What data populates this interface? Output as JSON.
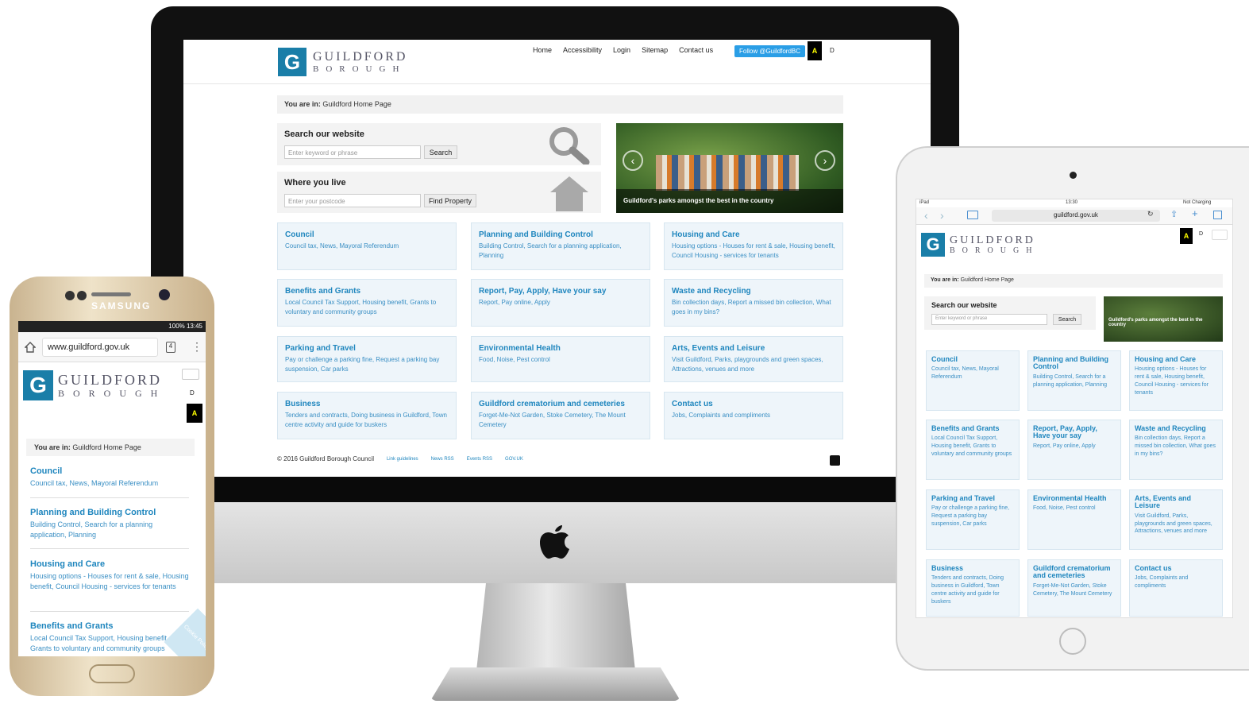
{
  "site": {
    "logo_letter": "G",
    "logo_line1": "GUILDFORD",
    "logo_line2": "BOROUGH",
    "nav": [
      "Home",
      "Accessibility",
      "Login",
      "Sitemap",
      "Contact us"
    ],
    "twitter": "Follow @GuildfordBC",
    "contrast_a": "A",
    "contrast_d": "D",
    "breadcrumb_prefix": "You are in:",
    "breadcrumb_page": "Guildford Home Page",
    "search_title": "Search our website",
    "search_placeholder": "Enter keyword or phrase",
    "search_button": "Search",
    "where_title": "Where you live",
    "postcode_placeholder": "Enter your postcode",
    "find_button": "Find Property",
    "carousel_caption": "Guildford's parks amongst the best in the country",
    "cards": [
      {
        "title": "Council",
        "desc": "Council tax, News, Mayoral Referendum"
      },
      {
        "title": "Planning and Building Control",
        "desc": "Building Control, Search for a planning application, Planning"
      },
      {
        "title": "Housing and Care",
        "desc": "Housing options - Houses for rent & sale, Housing benefit, Council Housing - services for tenants"
      },
      {
        "title": "Benefits and Grants",
        "desc": "Local Council Tax Support, Housing benefit, Grants to voluntary and community groups"
      },
      {
        "title": "Report, Pay, Apply, Have your say",
        "desc": "Report, Pay online, Apply"
      },
      {
        "title": "Waste and Recycling",
        "desc": "Bin collection days, Report a missed bin collection, What goes in my bins?"
      },
      {
        "title": "Parking and Travel",
        "desc": "Pay or challenge a parking fine, Request a parking bay suspension, Car parks"
      },
      {
        "title": "Environmental Health",
        "desc": "Food, Noise, Pest control"
      },
      {
        "title": "Arts, Events and Leisure",
        "desc": "Visit Guildford, Parks, playgrounds and green spaces, Attractions, venues and more"
      },
      {
        "title": "Business",
        "desc": "Tenders and contracts, Doing business in Guildford, Town centre activity and guide for buskers"
      },
      {
        "title": "Guildford crematorium and cemeteries",
        "desc": "Forget-Me-Not Garden, Stoke Cemetery, The Mount Cemetery"
      },
      {
        "title": "Contact us",
        "desc": "Jobs, Complaints and compliments"
      }
    ],
    "copyright": "© 2016 Guildford Borough Council",
    "footer_links": [
      "Link guidelines",
      "News RSS",
      "Events RSS",
      "GOV.UK"
    ]
  },
  "phone": {
    "brand": "SAMSUNG",
    "status_right": "100% 13:45",
    "url": "www.guildford.gov.uk",
    "tabs_count": "4",
    "cookie": "Cookie Policy"
  },
  "tablet": {
    "status_left": "iPad",
    "time": "13:30",
    "status_right": "Not Charging",
    "url": "guildford.gov.uk"
  },
  "colors": {
    "brand": "#1a7ea8",
    "link": "#1f86be"
  },
  "icons": [
    "search-icon",
    "house-icon",
    "apple-logo-icon",
    "home-icon",
    "menu-icon",
    "chevron-left-icon",
    "chevron-right-icon",
    "reload-icon",
    "share-icon",
    "plus-icon",
    "tabs-icon",
    "book-icon"
  ]
}
